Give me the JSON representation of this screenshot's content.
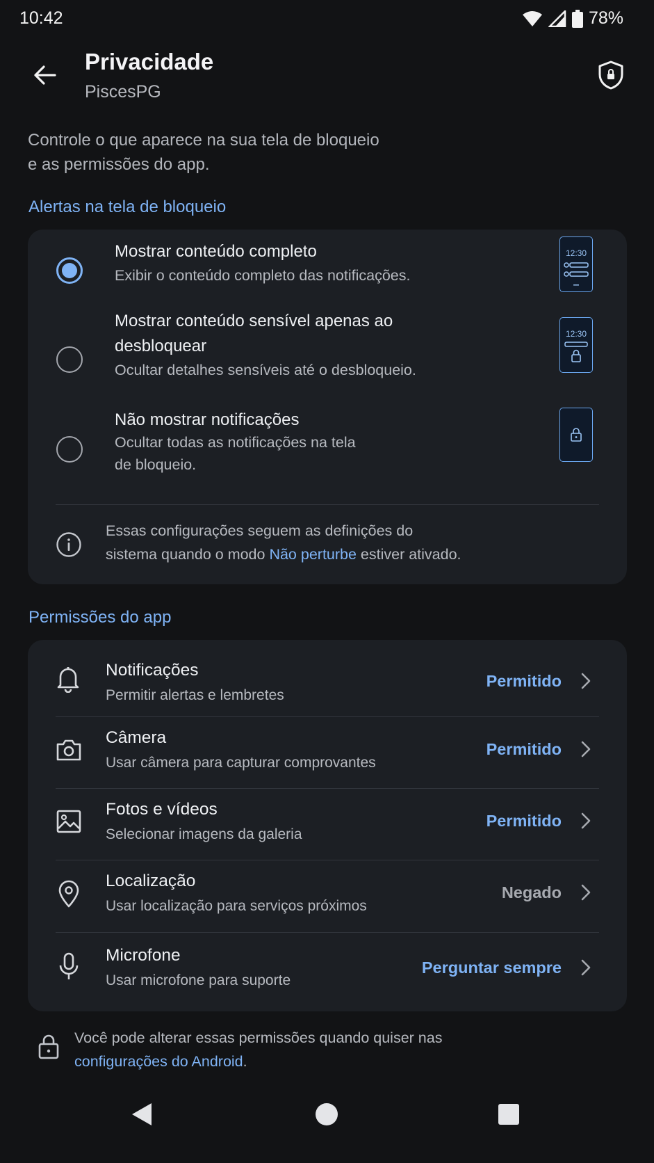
{
  "status_bar": {
    "time": "10:42",
    "battery": "78%"
  },
  "header": {
    "title": "Privacidade",
    "subtitle": "PiscesPG"
  },
  "intro": {
    "line1": "Controle o que aparece na sua tela de bloqueio",
    "line2": "e as permissões do app."
  },
  "lock_screen": {
    "section_label": "Alertas na tela de bloqueio",
    "options": [
      {
        "title": "Mostrar conteúdo completo",
        "description": "Exibir o conteúdo completo das notificações.",
        "selected": true,
        "illustration_time": "12:30"
      },
      {
        "title_line1": "Mostrar conteúdo sensível apenas ao",
        "title_line2": "desbloquear",
        "description": "Ocultar detalhes sensíveis até o desbloqueio.",
        "selected": false,
        "illustration_time": "12:30"
      },
      {
        "title": "Não mostrar notificações",
        "description_line1": "Ocultar todas as notificações na tela",
        "description_line2": "de bloqueio.",
        "selected": false
      }
    ],
    "info": {
      "line1": "Essas configurações seguem as definições do",
      "line2_prefix": "sistema quando o modo ",
      "link": "Não perturbe",
      "line2_suffix": " estiver ativado."
    }
  },
  "permissions": {
    "section_label": "Permissões do app",
    "items": [
      {
        "icon": "bell-icon",
        "title": "Notificações",
        "description": "Permitir alertas e lembretes",
        "status": "Permitido"
      },
      {
        "icon": "camera-icon",
        "title": "Câmera",
        "description": "Usar câmera para capturar comprovantes",
        "status": "Permitido"
      },
      {
        "icon": "image-icon",
        "title": "Fotos e vídeos",
        "description": "Selecionar imagens da galeria",
        "status": "Permitido"
      },
      {
        "icon": "location-pin-icon",
        "title": "Localização",
        "description": "Usar localização para serviços próximos",
        "status": "Negado"
      },
      {
        "icon": "microphone-icon",
        "title": "Microfone",
        "description": "Usar microfone para suporte",
        "status": "Perguntar sempre"
      }
    ]
  },
  "footer": {
    "line1": "Você pode alterar essas permissões quando quiser nas",
    "link": "configurações do Android",
    "suffix": "."
  },
  "colors": {
    "accent": "#7fb3f5",
    "background": "#121315",
    "card": "#1c1f24"
  }
}
